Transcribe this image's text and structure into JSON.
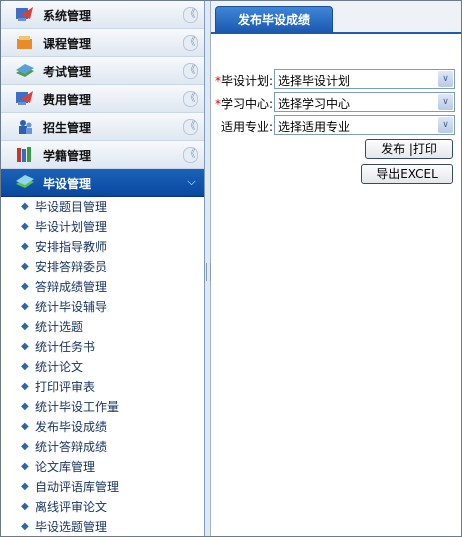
{
  "sidebar": {
    "categories": [
      {
        "label": "系统管理",
        "icon": "system-icon"
      },
      {
        "label": "课程管理",
        "icon": "course-icon"
      },
      {
        "label": "考试管理",
        "icon": "exam-icon"
      },
      {
        "label": "费用管理",
        "icon": "fee-icon"
      },
      {
        "label": "招生管理",
        "icon": "enrollment-icon"
      },
      {
        "label": "学籍管理",
        "icon": "student-records-icon"
      },
      {
        "label": "毕设管理",
        "icon": "graduation-design-icon"
      }
    ],
    "active_index": 6,
    "sub_items": [
      "毕设题目管理",
      "毕设计划管理",
      "安排指导教师",
      "安排答辩委员",
      "答辩成绩管理",
      "统计毕设辅导",
      "统计选题",
      "统计任务书",
      "统计论文",
      "打印评审表",
      "统计毕设工作量",
      "发布毕设成绩",
      "统计答辩成绩",
      "论文库管理",
      "自动评语库管理",
      "离线评审论文",
      "毕设选题管理"
    ]
  },
  "main": {
    "tab_label": "发布毕设成绩",
    "fields": [
      {
        "required": true,
        "label": "毕设计划:",
        "value": "选择毕设计划"
      },
      {
        "required": true,
        "label": "学习中心:",
        "value": "选择学习中心"
      },
      {
        "required": false,
        "label": "适用专业:",
        "value": "选择适用专业"
      }
    ],
    "publish_button": "发布 |打印",
    "export_button": "导出EXCEL"
  },
  "colors": {
    "accent": "#1a57ad",
    "active_category": "#0d4ea6",
    "required_mark": "#d00000",
    "link": "#1a3560"
  }
}
